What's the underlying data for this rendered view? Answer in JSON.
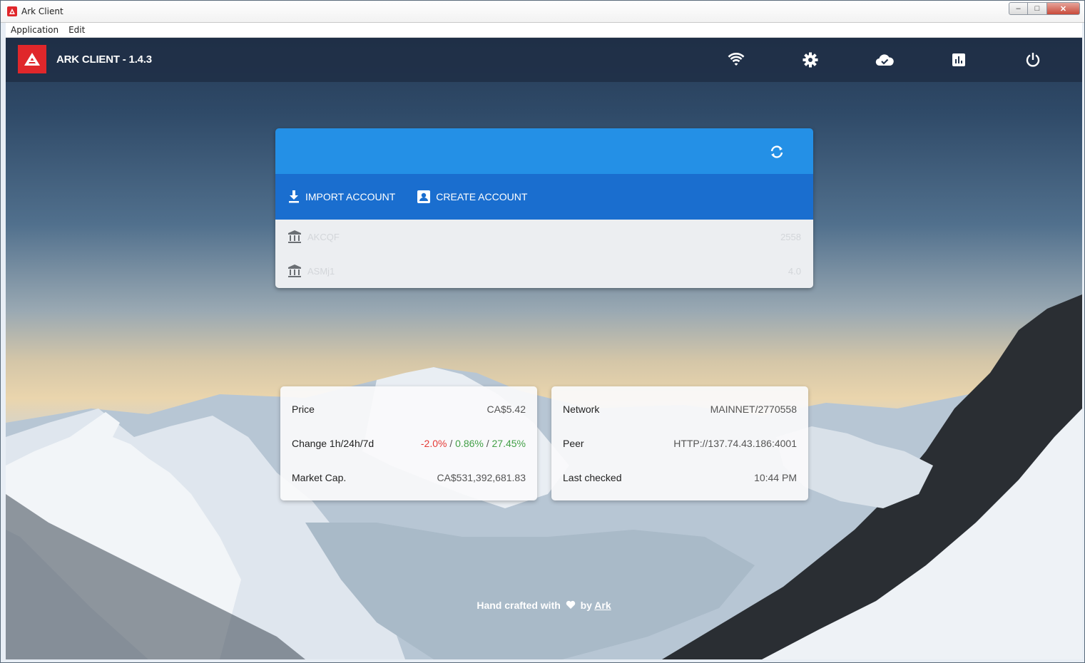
{
  "window": {
    "title": "Ark Client",
    "controls": {
      "minimize": "–",
      "maximize": "□",
      "close": "✕"
    }
  },
  "menu": {
    "items": [
      "Application",
      "Edit"
    ]
  },
  "header": {
    "brand": "ARK CLIENT - 1.4.3",
    "icons": [
      "wifi-icon",
      "gear-icon",
      "cloud-check-icon",
      "chart-icon",
      "power-icon"
    ]
  },
  "accounts": {
    "import_label": "IMPORT ACCOUNT",
    "create_label": "CREATE ACCOUNT",
    "list": [
      {
        "name": "AKCQF",
        "balance": "2558"
      },
      {
        "name": "ASMj1",
        "balance": "4.0"
      }
    ]
  },
  "market": {
    "price_label": "Price",
    "price_value": "CA$5.42",
    "change_label": "Change 1h/24h/7d",
    "change_1h": "-2.0%",
    "change_24h": "0.86%",
    "change_7d": "27.45%",
    "change_sep": " / ",
    "cap_label": "Market Cap.",
    "cap_value": "CA$531,392,681.83"
  },
  "network": {
    "network_label": "Network",
    "network_value": "MAINNET/2770558",
    "peer_label": "Peer",
    "peer_value": "HTTP://137.74.43.186:4001",
    "checked_label": "Last checked",
    "checked_value": "10:44 PM"
  },
  "footer": {
    "prefix": "Hand crafted with",
    "by": "by",
    "link": "Ark"
  },
  "colors": {
    "brand_red": "#e0272b",
    "card_blue": "#2490e6",
    "actions_blue": "#1a6ecf",
    "negative": "#e53935",
    "positive": "#43a047"
  }
}
